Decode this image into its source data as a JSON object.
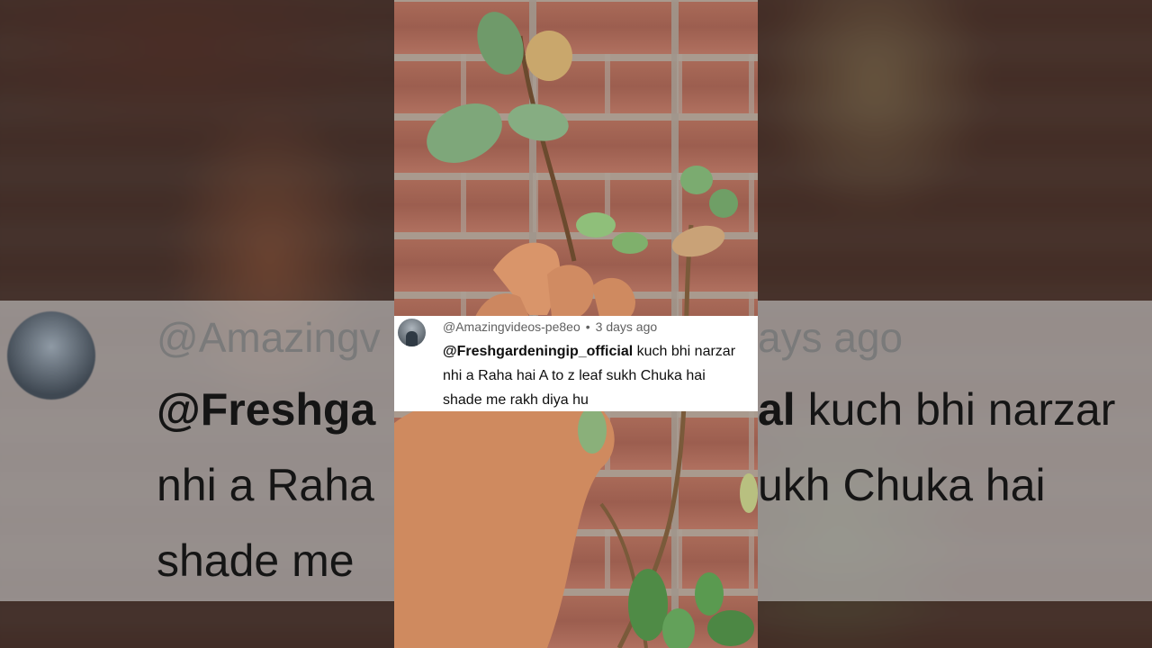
{
  "comment": {
    "author": "@Amazingvideos-pe8eo",
    "separator": "•",
    "time": "3 days ago",
    "mention": "@Freshgardeningip_official",
    "line1_rest": " kuch bhi narzar",
    "line2": "nhi a Raha hai A to z leaf sukh Chuka hai",
    "line3": "shade me rakh diya hu"
  },
  "background_text": {
    "handle_fragment": "@Amazingv",
    "time_fragment": "ays ago",
    "mention_fragment": "@Freshga",
    "mention_tail": "al",
    "line1_tail": " kuch bhi narzar",
    "line2_left": "nhi a Raha",
    "line2_right": "ukh Chuka hai",
    "line3_left": "shade me"
  },
  "colors": {
    "card_bg": "#ffffff",
    "meta_text": "#606060",
    "body_text": "#0f0f0f"
  },
  "icons": {
    "avatar": "user-avatar-photo"
  }
}
